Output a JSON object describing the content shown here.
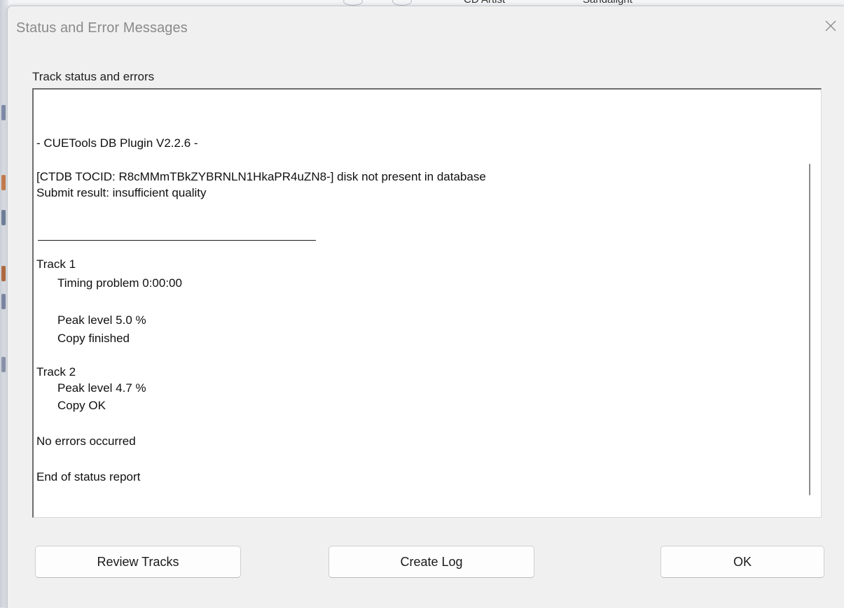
{
  "background": {
    "header_text_1": "CD Artist",
    "header_text_2": "Sandalight"
  },
  "dialog": {
    "title": "Status and Error Messages",
    "close_glyph": "close-icon"
  },
  "group": {
    "label": "Track status and errors"
  },
  "log": {
    "plugin_line": "- CUETools DB Plugin V2.2.6 -",
    "ctdb_line": "[CTDB TOCID: R8cMMmTBkZYBRNLN1HkaPR4uZN8-] disk not present in database",
    "submit_line": "Submit result: insufficient quality",
    "track1_title": "Track  1",
    "track1_timing": "Timing problem 0:00:00",
    "track1_peak": "Peak level 5.0 %",
    "track1_status": "Copy finished",
    "track2_title": "Track  2",
    "track2_peak": "Peak level 4.7 %",
    "track2_status": "Copy OK",
    "summary": "No errors occurred",
    "end": "End of status report"
  },
  "buttons": {
    "review": "Review Tracks",
    "create_log": "Create Log",
    "ok": "OK"
  }
}
